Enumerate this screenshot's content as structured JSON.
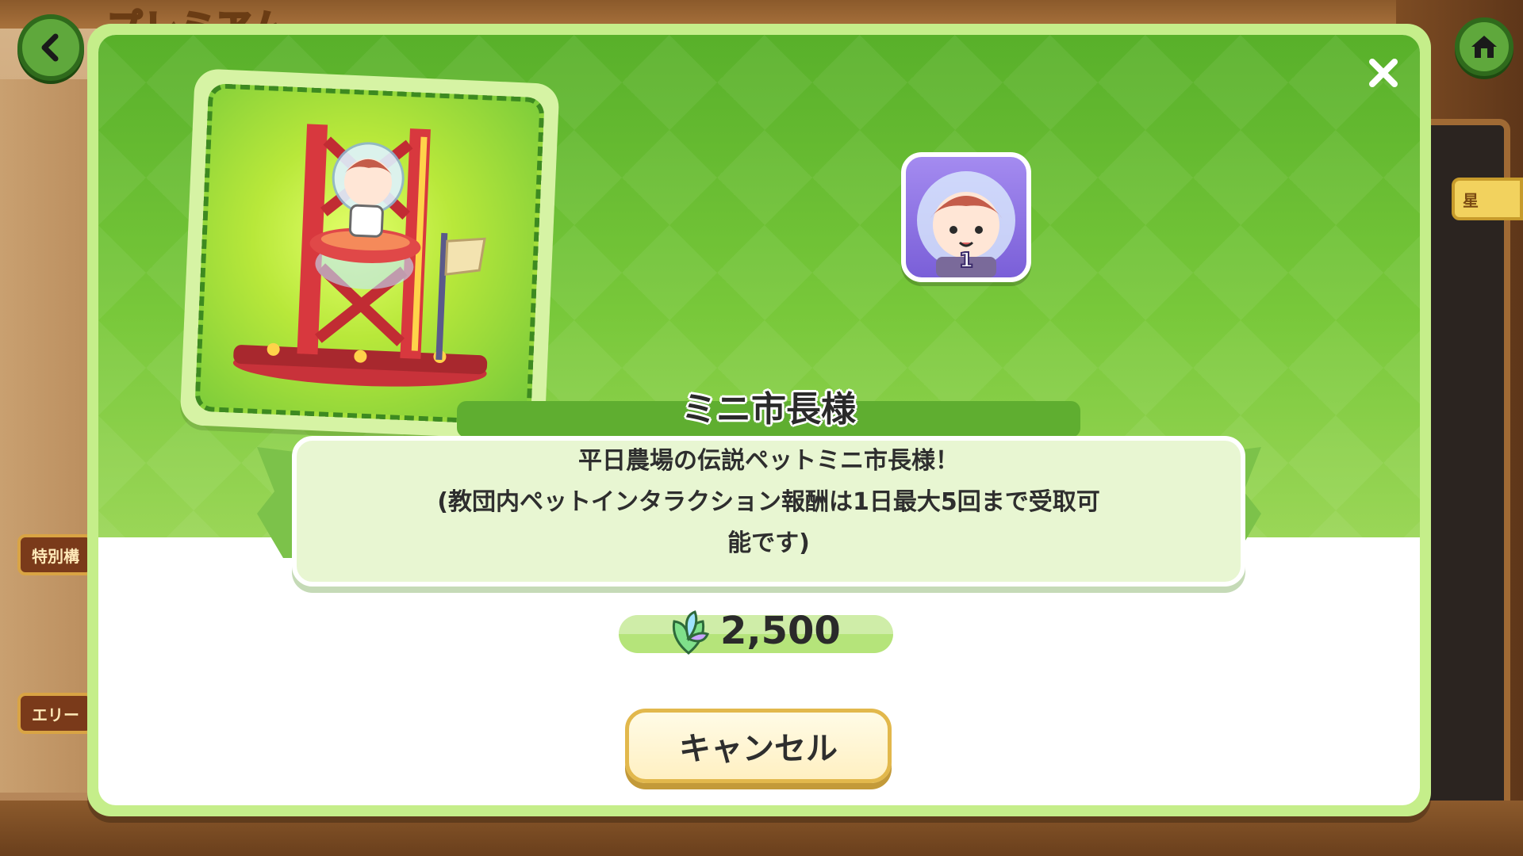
{
  "background": {
    "title": "プレミアム",
    "side_labels": [
      "特別構",
      "エリー"
    ],
    "right_badge": "星"
  },
  "navigation": {
    "back_icon": "chevron-left-icon",
    "home_icon": "home-icon"
  },
  "dialog": {
    "close_icon": "close-icon",
    "item_name": "ミニ市長様",
    "description": "平日農場の伝説ペットミニ市長様！\n(教団内ペットインタラクション報酬は1日最大5回まで受取可\n能です)",
    "reward_icon": "character-portrait-icon",
    "reward_count": "1",
    "price_icon": "leaf-crystal-icon",
    "price": "2,500",
    "cancel_label": "キャンセル"
  },
  "colors": {
    "dialog_frame": "#c5ee8a",
    "dialog_green": "#6cbf35",
    "name_bar": "#5fae30",
    "cancel_border": "#e2b84c",
    "reward_bg": "#8d72e4"
  }
}
